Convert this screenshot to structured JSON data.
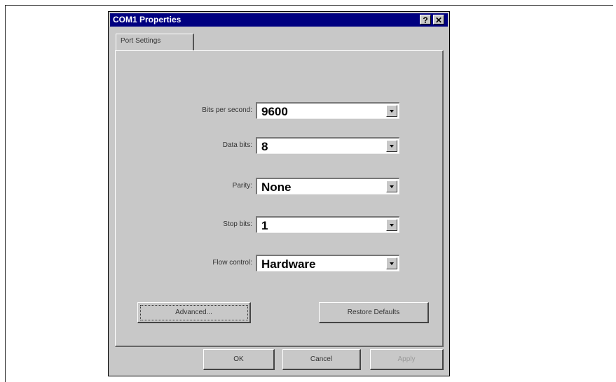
{
  "dialog": {
    "title": "COM1 Properties",
    "help_label": "?",
    "close_label": "✕"
  },
  "tabs": [
    {
      "label": "Port Settings",
      "active": true
    }
  ],
  "fields": [
    {
      "label": "Bits per second:",
      "value": "9600"
    },
    {
      "label": "Data bits:",
      "value": "8"
    },
    {
      "label": "Parity:",
      "value": "None"
    },
    {
      "label": "Stop bits:",
      "value": "1"
    },
    {
      "label": "Flow control:",
      "value": "Hardware"
    }
  ],
  "buttons": {
    "advanced": "Advanced...",
    "restore_defaults": "Restore Defaults",
    "ok": "OK",
    "cancel": "Cancel",
    "apply": "Apply"
  },
  "colors": {
    "titlebar": "#000080",
    "face": "#c8c8c8"
  }
}
